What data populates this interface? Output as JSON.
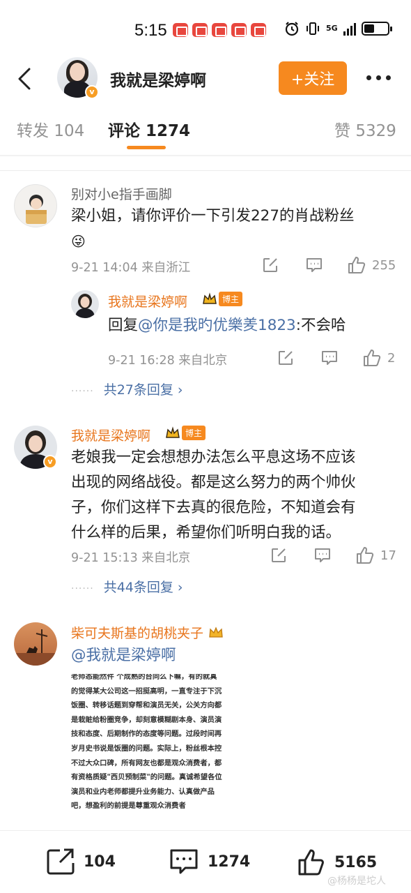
{
  "status_bar": {
    "time": "5:15",
    "network": "5G"
  },
  "header": {
    "title": "我就是梁婷啊",
    "follow_label": "+关注"
  },
  "tabs": [
    {
      "label": "转发",
      "count": "104"
    },
    {
      "label": "评论",
      "count": "1274"
    },
    {
      "label": "赞",
      "count": "5329"
    }
  ],
  "comments": [
    {
      "username": "别对小e指手画脚",
      "text": "梁小姐，请你评价一下引发227的肖战粉丝",
      "emoji": "😜",
      "date": "9-21 14:04",
      "location": "来自浙江",
      "likes": "255",
      "reply": {
        "username": "我就是梁婷啊",
        "badge": "博主",
        "prefix": "回复",
        "mention": "@你是我旳优樂羑1823",
        "text": ":不会哈",
        "date": "9-21 16:28",
        "location": "来自北京",
        "likes": "2"
      },
      "replies_link": "共27条回复 ›"
    },
    {
      "username": "我就是梁婷啊",
      "badge": "博主",
      "lines": [
        "老娘我一定会想想办法怎么平息这场不应该",
        "出现的网络战役。都是这么努力的两个帅伙",
        "子，你们这样下去真的很危险，不知道会有",
        "什么样的后果，希望你们听明白我的话。"
      ],
      "date": "9-21 15:13",
      "location": "来自北京",
      "likes": "17",
      "replies_link": "共44条回复 ›"
    },
    {
      "username": "柴可夫斯基的胡桃夹子",
      "mention": "@我就是梁婷啊",
      "image_lines": [
        "老师态能然件  个成熟的台同么下嘛，有的就真",
        "的觉得某大公司这一招挺高明，一直专注于下沉",
        "饭圈、转移话题到穿帮和演员无关，公关方向都",
        "是栽赃给粉圈竞争，却刻意模糊剧本身、演员演",
        "技和态度、后期制作的态度等问题。过段时间再",
        "岁月史书说是饭圈的问题。实际上，粉丝根本控",
        "不过大众口碑，所有网友也都是观众消费者，都",
        "有资格质疑\"西贝预制菜\"的问题。真诚希望各位",
        "演员和业内老师都提升业务能力、认真做产品",
        "吧，想盈利的前提是尊重观众消费者"
      ]
    }
  ],
  "bottom_bar": {
    "reposts": "104",
    "comments": "1274",
    "likes": "5165"
  },
  "watermark": "@杨杨是坨人",
  "colors": {
    "accent": "#f6891f",
    "link": "#4a6fa5",
    "username_orange": "#e8761e"
  }
}
